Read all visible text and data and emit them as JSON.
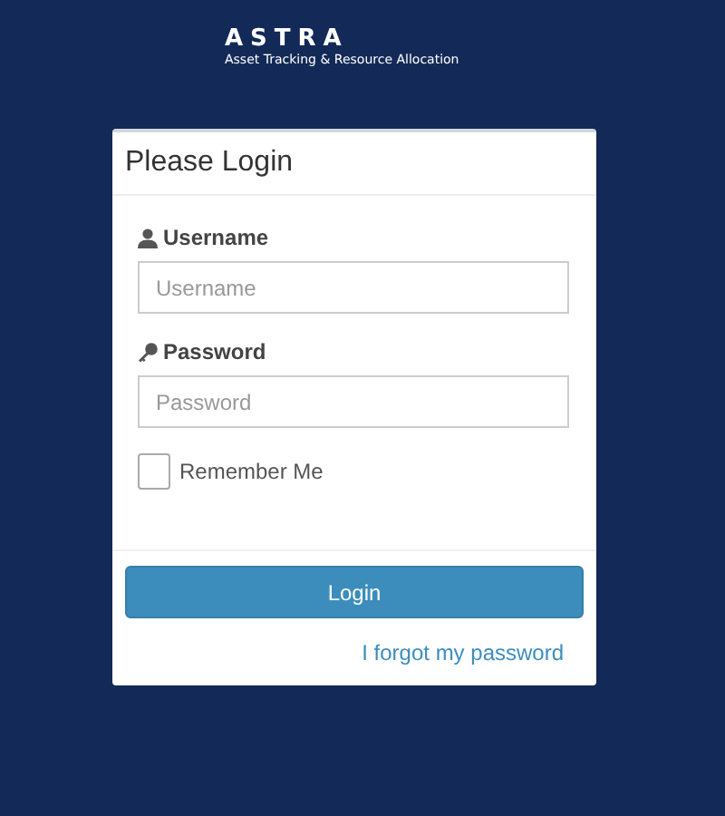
{
  "brand": {
    "name": "ASTRA",
    "tagline": "Asset Tracking & Resource Allocation"
  },
  "panel": {
    "title": "Please Login"
  },
  "fields": [
    {
      "label": "Username",
      "placeholder": "Username",
      "kind": "user"
    },
    {
      "label": "Password",
      "placeholder": "Password",
      "kind": "key"
    }
  ],
  "remember": {
    "label": "Remember Me",
    "checked": false
  },
  "login_button": "Login",
  "forgot_link": "I forgot my password"
}
